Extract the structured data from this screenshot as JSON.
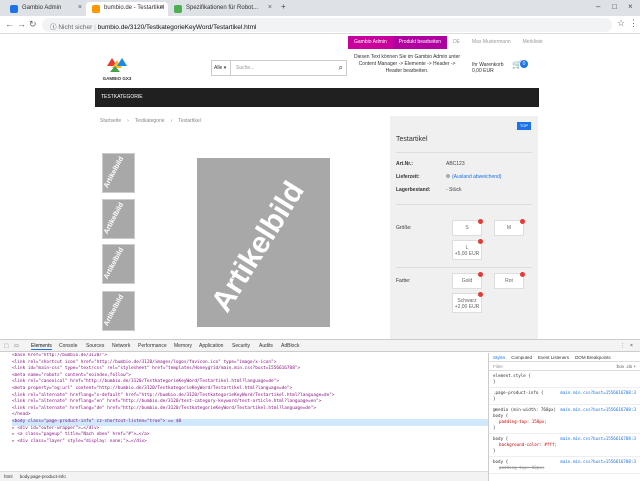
{
  "browser": {
    "tabs": [
      {
        "title": "Gambio Admin",
        "active": false
      },
      {
        "title": "bumbio.de - Testartikel",
        "active": true
      },
      {
        "title": "Spezifikationen für Robot...",
        "active": false
      }
    ],
    "security": "Nicht sicher",
    "url": "bumbio.de/3120/TestkategorieKeyWord/Testartikel.html"
  },
  "topbar": {
    "items": [
      "Gambio Admin",
      "Produkt bearbeiten",
      "DE",
      "Max Mustermann",
      "Merkliste"
    ]
  },
  "header": {
    "logo_text": "GAMBIO GX3",
    "search_category": "Alle",
    "search_placeholder": "Suche...",
    "cms_hint": "Diesen Text können Sie im Gambio Admin unter Content Manager -> Elemente -> Header -> Header bearbeiten.",
    "cart_line1": "Ihr Warenkorb",
    "cart_line2": "0,00 EUR",
    "cart_count": "0"
  },
  "navbar": {
    "item": "TESTKATEGORIE"
  },
  "breadcrumb": [
    "Startseite",
    "Testkategorie",
    "Testartikel"
  ],
  "product": {
    "thumb_text": "Artikelbild",
    "image_text": "Artikelbild",
    "top_badge": "TOP",
    "title": "Testartikel",
    "artnr_label": "Art.Nr.:",
    "artnr": "ABC123",
    "lieferzeit_label": "Lieferzeit:",
    "lieferzeit": "(Ausland abweichend)",
    "lagerbestand_label": "Lagerbestand:",
    "lagerbestand": "- Stück",
    "size_label": "Größe:",
    "sizes": [
      "S",
      "M",
      "L\n+5,00 EUR"
    ],
    "color_label": "Farbe:",
    "colors": [
      "Gold",
      "Rot",
      "Schwarz\n+2,00 EUR"
    ]
  },
  "devtools": {
    "tabs": [
      "Elements",
      "Console",
      "Sources",
      "Network",
      "Performance",
      "Memory",
      "Application",
      "Security",
      "Audits",
      "AdBlock"
    ],
    "dom_lines": [
      "<base href=\"http://bumbio.de/3120/\">",
      "<link rel=\"shortcut icon\" href=\"http://bumbio.de/3120/images/logos/favicon.ico\" type=\"image/x-icon\">",
      "<link id=\"main-css\" type=\"text/css\" rel=\"stylesheet\" href=\"templates/Honeygrid/main.min.css?bust=1556616708\">",
      "<meta name=\"robots\" content=\"noindex,follow\">",
      "<link rel=\"canonical\" href=\"http://bumbio.de/3120/TestkategorieKeyWord/Testartikel.html?language=de\">",
      "<meta property=\"og:url\" content=\"http://bumbio.de/3120/TestkategorieKeyWord/Testartikel.html?language=de\">",
      "<link rel=\"alternate\" hreflang=\"x-default\" href=\"http://bumbio.de/3120/TestkategorieKeyWord/Testartikel.html?language=de\">",
      "<link rel=\"alternate\" hreflang=\"en\" href=\"http://bumbio.de/3120/test-category-keyword/test-article.html?language=en\">",
      "<link rel=\"alternate\" hreflang=\"de\" href=\"http://bumbio.de/3120/TestkategorieKeyWord/Testartikel.html?language=de\">",
      "</head>",
      "<body class=\"page-product-info\" cz-shortcut-listen=\"true\"> == $0",
      "▸ <div id=\"outer-wrapper\">…</div>",
      "▸ <a class=\"pageup\" title=\"Nach oben\" href=\"#\">…</a>",
      "▸ <div class=\"layer\" style=\"display: none;\">…</div>"
    ],
    "status_path": [
      "html",
      "body.page-product-info"
    ],
    "styles_tabs": [
      "Styles",
      "Computed",
      "Event Listeners",
      "DOM Breakpoints"
    ],
    "filter_placeholder": "Filter",
    "filter_right": ":hov .cls +",
    "rules": [
      {
        "selector": "element.style {",
        "src": "",
        "props": [
          "}"
        ]
      },
      {
        "selector": ".page-product-info {",
        "src": "main.min.css?bust=1556616708:3",
        "props": [
          "}"
        ]
      },
      {
        "selector": "@media (min-width: 768px)",
        "src": "main.min.css?bust=1556616708:3",
        "props": [
          "body {",
          "padding-top: 150px;",
          "}"
        ]
      },
      {
        "selector": "body {",
        "src": "main.min.css?bust=1556616708:3",
        "props": [
          "background-color: #fff;",
          "}"
        ]
      },
      {
        "selector": "body {",
        "src": "main.min.css?bust=1556616708:3",
        "props": [
          "padding-top: 80px;"
        ]
      }
    ]
  }
}
